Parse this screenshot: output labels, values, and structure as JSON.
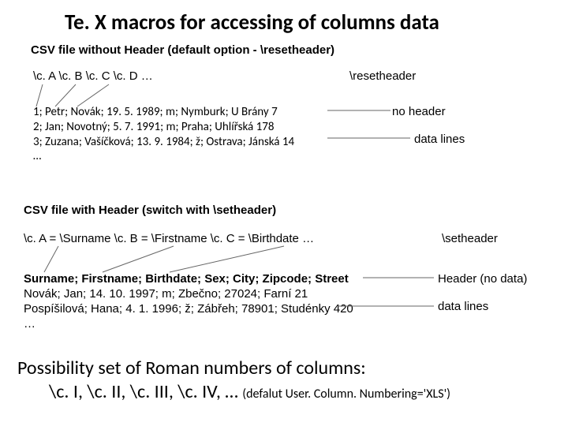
{
  "title": "Te. X macros for accessing of columns data",
  "section1": {
    "heading": "CSV file without Header (default option - \\resetheader)",
    "macros": "\\c. A   \\c. B   \\c. C   \\c. D   …",
    "reset": "\\resetheader",
    "noHeaderLabel": "no header",
    "dataLinesLabel": "data lines",
    "csvLines": "1; Petr; Novák; 19. 5. 1989; m; Nymburk; U Brány 7\n2; Jan; Novotný; 5. 7. 1991; m; Praha; Uhlířská 178\n3; Zuzana; Vašíčková; 13. 9. 1984; ž; Ostrava; Jánská 14\n…"
  },
  "section2": {
    "heading": "CSV file with Header (switch with \\setheader)",
    "macros": "\\c. A  = \\Surname        \\c. B = \\Firstname   \\c. C = \\Birthdate  …",
    "setheader": "\\setheader",
    "headerLine": "Surname; Firstname; Birthdate; Sex; City; Zipcode; Street",
    "csvLines": "Novák; Jan; 14. 10. 1997; m; Zbečno; 27024; Farní 21\nPospíšilová; Hana; 4. 1. 1996; ž; Zábřeh; 78901; Studénky 420\n…",
    "headerNoData": "Header (no data)",
    "dataLinesLabel": "data lines"
  },
  "footer": {
    "line1": "Possibility set of Roman numbers of columns:",
    "line2a": "\\c. I, \\c. II, \\c. III, \\c. IV, … ",
    "line2b": "(defalut  User. Column. Numbering='XLS')"
  }
}
